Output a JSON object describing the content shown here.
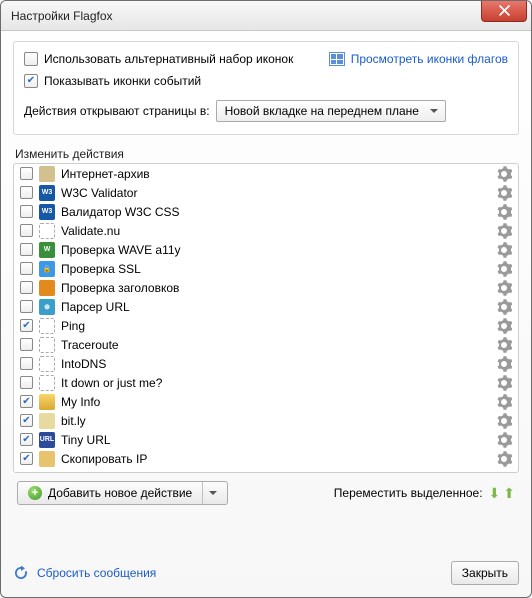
{
  "window": {
    "title": "Настройки Flagfox"
  },
  "topgroup": {
    "alt_icons_label": "Использовать альтернативный набор иконок",
    "alt_icons_checked": false,
    "preview_link": "Просмотреть иконки флагов",
    "show_event_icons_label": "Показывать иконки событий",
    "show_event_icons_checked": true,
    "open_in_label": "Действия открывают страницы в:",
    "open_in_value": "Новой вкладке на переднем плане"
  },
  "actions": {
    "title": "Изменить действия",
    "add_label": "Добавить новое действие",
    "move_label": "Переместить выделенное:",
    "items": [
      {
        "label": "Интернет-архив",
        "checked": false,
        "icon": "archive"
      },
      {
        "label": "W3C Validator",
        "checked": false,
        "icon": "w3c",
        "icon_text": "W3"
      },
      {
        "label": "Валидатор W3C CSS",
        "checked": false,
        "icon": "w3c2",
        "icon_text": "W3"
      },
      {
        "label": "Validate.nu",
        "checked": false,
        "icon": "dotted"
      },
      {
        "label": "Проверка WAVE a11y",
        "checked": false,
        "icon": "wave",
        "icon_text": "W"
      },
      {
        "label": "Проверка SSL",
        "checked": false,
        "icon": "ssl",
        "icon_text": "🔒"
      },
      {
        "label": "Проверка заголовков",
        "checked": false,
        "icon": "head"
      },
      {
        "label": "Парсер URL",
        "checked": false,
        "icon": "parse",
        "icon_text": "⊕"
      },
      {
        "label": "Ping",
        "checked": true,
        "icon": "dotted"
      },
      {
        "label": "Traceroute",
        "checked": false,
        "icon": "dotted"
      },
      {
        "label": "IntoDNS",
        "checked": false,
        "icon": "dotted"
      },
      {
        "label": "It down or just me?",
        "checked": false,
        "icon": "dotted"
      },
      {
        "label": "My Info",
        "checked": true,
        "icon": "myinfo"
      },
      {
        "label": "bit.ly",
        "checked": true,
        "icon": "bitly"
      },
      {
        "label": "Tiny URL",
        "checked": true,
        "icon": "tiny",
        "icon_text": "URL"
      },
      {
        "label": "Скопировать IP",
        "checked": true,
        "icon": "copy"
      }
    ]
  },
  "footer": {
    "reset_label": "Сбросить сообщения",
    "close_label": "Закрыть"
  }
}
